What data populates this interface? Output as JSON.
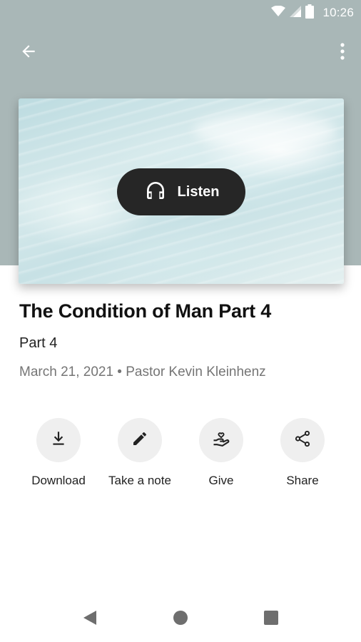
{
  "status_bar": {
    "time": "10:26",
    "icons": [
      "wifi-icon",
      "cell-signal-icon",
      "battery-icon"
    ]
  },
  "app_bar": {
    "back_icon": "arrow-back-icon",
    "menu_icon": "more-vert-icon"
  },
  "hero": {
    "listen_label": "Listen",
    "listen_icon": "headphones-icon"
  },
  "sermon": {
    "title": "The Condition of Man Part 4",
    "subtitle": "Part 4",
    "meta": "March 21, 2021 • Pastor Kevin Kleinhenz"
  },
  "actions": [
    {
      "label": "Download",
      "icon": "download-icon"
    },
    {
      "label": "Take a note",
      "icon": "pencil-icon"
    },
    {
      "label": "Give",
      "icon": "give-heart-hand-icon"
    },
    {
      "label": "Share",
      "icon": "share-icon"
    }
  ],
  "nav_bar": {
    "icons": [
      "nav-back-icon",
      "nav-home-icon",
      "nav-recents-icon"
    ]
  },
  "colors": {
    "header_bg": "#a9b7b7",
    "listen_bg": "#262626",
    "action_circle_bg": "#efefef",
    "meta_text": "#757575"
  }
}
